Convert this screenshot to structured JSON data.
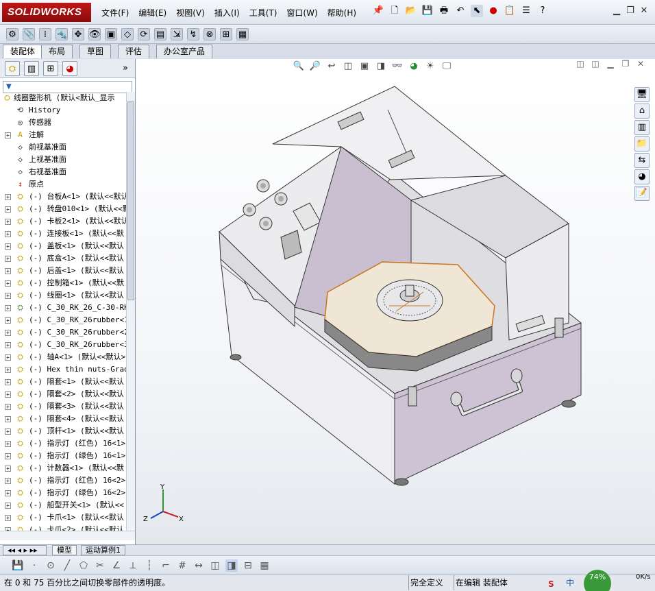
{
  "app": {
    "logo_text": "SOLIDWORKS",
    "brand_color": "#c01818"
  },
  "menu": [
    "文件(F)",
    "编辑(E)",
    "视图(V)",
    "插入(I)",
    "工具(T)",
    "窗口(W)",
    "帮助(H)"
  ],
  "command_tabs": [
    "装配体",
    "布局",
    "草图",
    "评估",
    "办公室产品"
  ],
  "feature_tree": {
    "root": "线圈整形机  (默认<默认_显示",
    "items": [
      {
        "label": "History",
        "icon": "history-icon"
      },
      {
        "label": "传感器",
        "icon": "sensor-icon"
      },
      {
        "label": "注解",
        "icon": "annotation-icon",
        "expandable": true
      },
      {
        "label": "前视基准面",
        "icon": "plane-icon"
      },
      {
        "label": "上视基准面",
        "icon": "plane-icon"
      },
      {
        "label": "右视基准面",
        "icon": "plane-icon"
      },
      {
        "label": "原点",
        "icon": "origin-icon"
      },
      {
        "label": "(-) 台板A<1> (默认<<默认",
        "icon": "part-icon",
        "expandable": true
      },
      {
        "label": "(-) 转盘010<1> (默认<<默",
        "icon": "part-icon",
        "expandable": true
      },
      {
        "label": "(-) 卡板2<1> (默认<<默认",
        "icon": "part-icon",
        "expandable": true
      },
      {
        "label": "(-) 连接板<1> (默认<<默",
        "icon": "part-icon",
        "expandable": true
      },
      {
        "label": "(-) 盖板<1> (默认<<默认",
        "icon": "part-icon",
        "expandable": true
      },
      {
        "label": "(-) 底盒<1> (默认<<默认",
        "icon": "part-icon",
        "expandable": true
      },
      {
        "label": "(-) 后盖<1> (默认<<默认",
        "icon": "part-icon",
        "expandable": true
      },
      {
        "label": "(-) 控制箱<1> (默认<<默",
        "icon": "part-icon",
        "expandable": true
      },
      {
        "label": "(-) 线圈<1> (默认<<默认",
        "icon": "part-icon",
        "expandable": true
      },
      {
        "label": "(-) C_30_RK_26_C-30-RK-",
        "icon": "subassembly-icon",
        "expandable": true
      },
      {
        "label": "(-) C_30_RK_26rubber<1>",
        "icon": "part-icon",
        "expandable": true
      },
      {
        "label": "(-) C_30_RK_26rubber<2>",
        "icon": "part-icon",
        "expandable": true
      },
      {
        "label": "(-) C_30_RK_26rubber<3>",
        "icon": "part-icon",
        "expandable": true
      },
      {
        "label": "(-) 轴A<1> (默认<<默认>",
        "icon": "part-icon",
        "expandable": true
      },
      {
        "label": "(-) Hex thin nuts-Grade",
        "icon": "part-icon",
        "expandable": true
      },
      {
        "label": "(-) 隔套<1> (默认<<默认",
        "icon": "part-icon",
        "expandable": true
      },
      {
        "label": "(-) 隔套<2> (默认<<默认",
        "icon": "part-icon",
        "expandable": true
      },
      {
        "label": "(-) 隔套<3> (默认<<默认",
        "icon": "part-icon",
        "expandable": true
      },
      {
        "label": "(-) 隔套<4> (默认<<默认",
        "icon": "part-icon",
        "expandable": true
      },
      {
        "label": "(-) 顶杆<1> (默认<<默认",
        "icon": "part-icon",
        "expandable": true
      },
      {
        "label": "(-) 指示灯 (红色) 16<1>",
        "icon": "part-icon",
        "expandable": true
      },
      {
        "label": "(-) 指示灯 (绿色) 16<1>",
        "icon": "part-icon",
        "expandable": true
      },
      {
        "label": "(-) 计数器<1> (默认<<默",
        "icon": "part-icon",
        "expandable": true
      },
      {
        "label": "(-) 指示灯 (红色) 16<2>",
        "icon": "part-icon",
        "expandable": true
      },
      {
        "label": "(-) 指示灯 (绿色) 16<2>",
        "icon": "part-icon",
        "expandable": true
      },
      {
        "label": "(-) 船型开关<1> (默认<<",
        "icon": "part-icon",
        "expandable": true
      },
      {
        "label": "(-) 卡爪<1> (默认<<默认",
        "icon": "part-icon",
        "expandable": true
      },
      {
        "label": "(-) 卡爪<2> (默认<<默认",
        "icon": "part-icon",
        "expandable": true
      }
    ]
  },
  "bottom_tabs": [
    "模型",
    "运动算例1"
  ],
  "status": {
    "message": "在 0 和 75 百分比之间切换零部件的透明度。",
    "state1": "完全定义",
    "state2": "在编辑 装配体",
    "net_percent": "74%",
    "net_speed": "0K/s",
    "ime": "中"
  },
  "triad": {
    "x": "X",
    "y": "Y",
    "z": "Z"
  }
}
